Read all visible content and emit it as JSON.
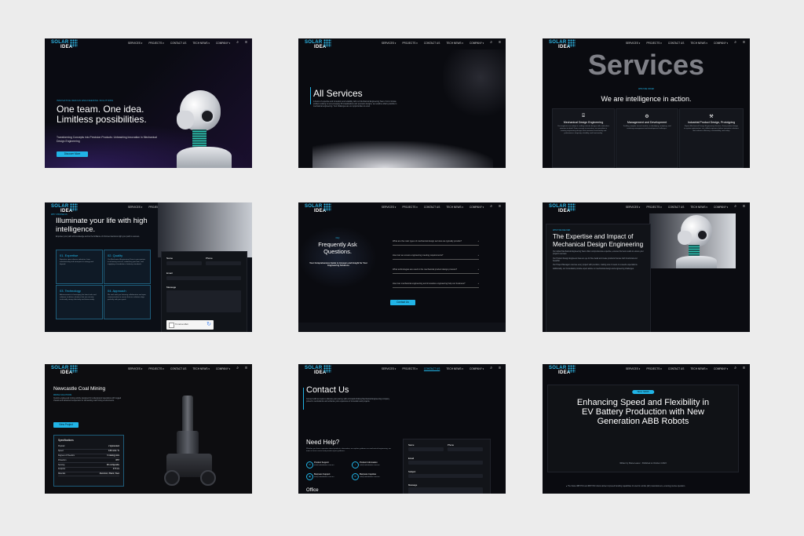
{
  "nav": {
    "logo_top": "SOLAR",
    "logo_bottom": "IDEA",
    "items": [
      "SERVICES ▾",
      "PROJECTS ▾",
      "CONTACT US",
      "TECH NEWS ▾",
      "COMPANY ▾"
    ],
    "search_icon": "search-icon",
    "menu_icon": "hamburger-icon"
  },
  "hero": {
    "eyebrow": "INNOVATIVE DESIGN ENGINEERING SOLUTIONS",
    "headline": "One team. One idea. Limitless possibilities.",
    "sub": "Transforming Concepts into Precision Products: Unleashing Innovation in Mechanical Design Engineering",
    "cta": "Discover More"
  },
  "all_services": {
    "title": "All Services",
    "body": "A fusion of expertise and innovation and reliability with our Mechanical Engineering Team. From intricate problem-solving to new emerging 3D visualizations and precision designs, we redefine what's possible in mechanical engineering. Your challenges are our opportunities to excel."
  },
  "services_page": {
    "big_title": "Services",
    "eyebrow": "WHAT WE OFFER",
    "tagline": "We are intelligence in action.",
    "cards": [
      {
        "title": "Mechanical Design Engineering",
        "text": "Our engineers are adept at crafting intricate designs with meticulous attention to detail. From concept to execution, we specialize in creating engineering designs that maximize functionality and performance, longevity, reliability, and functionality."
      },
      {
        "title": "Management and Development",
        "text": "Tackling complex issues head-on, in identifying, analyzing, and resolving management and development challenges."
      },
      {
        "title": "Industrial Product Design, Prototyping",
        "text": "Expert Mechanical Design Engineering Services: From product design to system optimization, our skilled engineers deliver innovative solutions that enhance efficiency, sustainability, and safety."
      }
    ]
  },
  "intelligence": {
    "eyebrow": "WHY CHOOSE US",
    "title": "Illuminate your life with high intelligence.",
    "intro": "Empower your path with knowledge and let the brilliance of informed decisions light your path to success.",
    "boxes": [
      {
        "title": "01. Expertise",
        "text": "Expertise spans diverse industries, from manufacturing and aerospace to energy and beyond."
      },
      {
        "title": "02. Quality",
        "text": "Our Mechanical Engineering Team is your partner in achieving success, embracing precision, and supplying a foundation of industry standards."
      },
      {
        "title": "03. Technology",
        "text": "Advancements in leveraging the latest tools and software to deliver solutions that are not only technically strong effectively and future-ready."
      },
      {
        "title": "04. Approach",
        "text": "We work with you fostering collaboration and open communication to ensure that our solutions align perfectly with your goals."
      }
    ],
    "form": {
      "name": "Name",
      "phone": "Phone",
      "email": "Email",
      "message": "Message",
      "captcha": "I'm not a robot"
    }
  },
  "faq": {
    "eyebrow": "FAQ",
    "title": "Frequently Ask Questions.",
    "sub": "Your Comprehensive Guide to Answers and Insight for Your Engineering Solutions",
    "questions": [
      "What are the main types of mechanical design services we typically provide?",
      "How can we ensure engineering meeting requirements?",
      "What technologies are used in the mechanical product design process?",
      "How can mechanical engineering and innovative engineering help our business?"
    ],
    "cta": "Contact Us"
  },
  "expertise": {
    "eyebrow": "WHAT WE DELIVER",
    "title": "The Expertise and Impact of Mechanical Design Engineering",
    "p1": "Our skilled Mechanical Engineering Team offers comprehensive expertise, ensures the best results to ensure your project's success.",
    "p2": "Our Product Design Engineers have an eye for fine detail and create products that are both functional and beautiful.",
    "p3": "Our Project Managers oversee every project with precision, making sure it meets or exceeds expectations.",
    "p4": "Additionally, our Consultants provide expert advice on mechanical design and engineering challenges."
  },
  "project": {
    "title": "Newcastle Coal Mining",
    "eyebrow": "MINING SOLUTIONS",
    "body": "Custom-engineered mining vehicle designed for underground operations with rugged chassis and advanced suspension for demanding coal mining environments.",
    "cta": "View Project",
    "spec_title": "Specifications",
    "specs": [
      [
        "Payload",
        "2 kg/standard"
      ],
      [
        "Speed",
        "0-80 units / hr"
      ],
      [
        "Degrees of Freedom",
        "6 rotating joints"
      ],
      [
        "Protection",
        "IP67"
      ],
      [
        "Sensing",
        "3D configurable"
      ],
      [
        "Footprint",
        "47.8 cm"
      ],
      [
        "Materials",
        "Aluminium, Plastic, Steel"
      ]
    ]
  },
  "contact": {
    "title": "Contact Us",
    "body": "Connect with our team to discuss your journey with a forward-thinking Mechanical Engineering company poised to revolutionize and enhance your experience of innovation and projects.",
    "help_title": "Need Help?",
    "help_body": "Whether you have a question about products, information, we explore guidance on mechanical engineering, our team is here to assist and provide expert guidance.",
    "items": [
      {
        "title": "Product Support",
        "email": "info@solarideatec.com.au"
      },
      {
        "title": "Product Information",
        "email": "info@solarideatec.com.au"
      },
      {
        "title": "Business Support",
        "email": "info@solarideatec.com.au"
      },
      {
        "title": "Business Inquiries",
        "email": "info@solarideatec.com.au"
      }
    ],
    "office": "Office",
    "form": {
      "name": "Name",
      "phone": "Phone",
      "email": "Email",
      "subject": "Subject",
      "message": "Message"
    }
  },
  "news": {
    "badge": "TECH NEWS",
    "title": "Enhancing Speed and Flexibility in EV Battery Production with New Generation ABB Robots",
    "meta": "Written by Shane Leaver · Published on October 4 2023",
    "bullet": "The Swiss IRB 5710 and IRB 5720 robots deliver improved handling capabilities for electric vehicle (EV) manufacturers, ensuring precise operation."
  }
}
